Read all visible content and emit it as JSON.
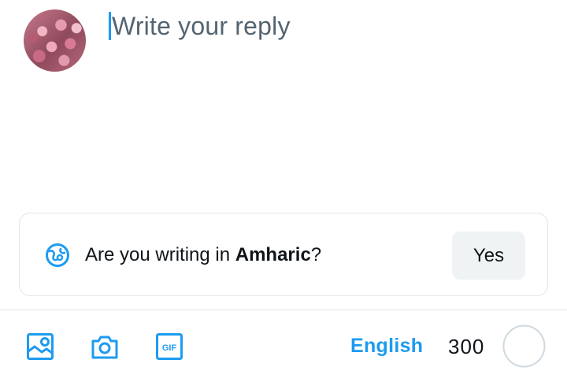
{
  "composer": {
    "avatar_icon": "user-avatar",
    "placeholder": "Write your reply"
  },
  "language_suggestion": {
    "icon": "globe-icon",
    "question_prefix": "Are you writing in ",
    "language": "Amharic",
    "question_suffix": "?",
    "yes_label": "Yes"
  },
  "toolbar": {
    "media_icon": "image-icon",
    "camera_icon": "camera-icon",
    "gif_icon": "gif-icon",
    "gif_text": "GIF",
    "language_label": "English",
    "char_count": "300",
    "progress_ring_icon": "character-progress-ring"
  },
  "colors": {
    "accent": "#1d9bf0",
    "placeholder": "#536471",
    "border": "#e1e6ea",
    "button_bg": "#eff3f4"
  }
}
